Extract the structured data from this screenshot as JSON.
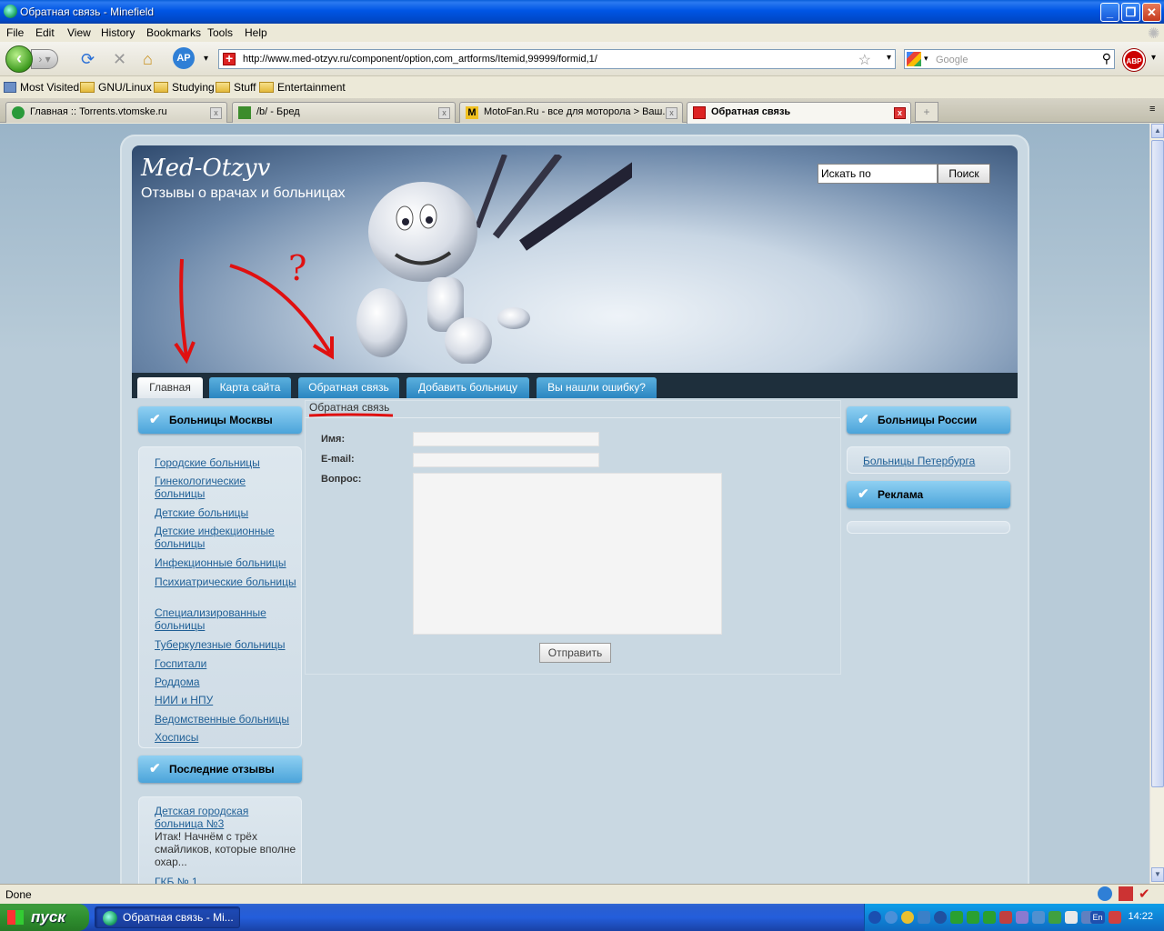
{
  "window": {
    "title": "Обратная связь - Minefield"
  },
  "menu": [
    "File",
    "Edit",
    "View",
    "History",
    "Bookmarks",
    "Tools",
    "Help"
  ],
  "address": {
    "url": "http://www.med-otzyv.ru/component/option,com_artforms/Itemid,99999/formid,1/"
  },
  "search": {
    "placeholder": "Google"
  },
  "bookmarks": [
    "Most Visited",
    "GNU/Linux",
    "Studying",
    "Stuff",
    "Entertainment"
  ],
  "tabs": [
    {
      "label": "Главная :: Torrents.vtomske.ru"
    },
    {
      "label": "/b/ - Бред"
    },
    {
      "label": "MotoFan.Ru - все для моторола > Ваш..."
    },
    {
      "label": "Обратная связь"
    }
  ],
  "site": {
    "name": "Med-Otzyv",
    "slogan": "Отзывы о врачах и больницах",
    "search_value": "Искать по",
    "search_button": "Поиск",
    "nav": [
      "Главная",
      "Карта сайта",
      "Обратная связь",
      "Добавить больницу",
      "Вы нашли ошибку?"
    ],
    "left": {
      "heading": "Больницы Москвы",
      "links": [
        "Городские больницы",
        "Гинекологические больницы",
        "Детские больницы",
        "Детские инфекционные больницы",
        "Инфекционные больницы",
        "Психиатрические больницы",
        "Специализированные больницы",
        "Туберкулезные больницы",
        "Госпитали",
        "Роддома",
        "НИИ и НПУ",
        "Ведомственные больницы",
        "Хосписы"
      ],
      "reviews_heading": "Последние отзывы",
      "review_link": "Детская городская больница №3",
      "review_text": "Итак! Начнём с трёх смайликов, которые вполне охар...",
      "review_link2": "ГКБ № 1"
    },
    "form": {
      "title": "Обратная связь",
      "name_label": "Имя:",
      "email_label": "E-mail:",
      "question_label": "Вопрос:",
      "submit": "Отправить"
    },
    "right": {
      "heading": "Больницы России",
      "link": "Больницы Петербурга",
      "ads_heading": "Реклама"
    },
    "annotation": "?"
  },
  "status": {
    "text": "Done"
  },
  "taskbar": {
    "start": "пуск",
    "task": "Обратная связь - Mi...",
    "lang": "En",
    "clock": "14:22"
  },
  "colors": {
    "accent": "#4ba4da",
    "annotation": "#e01010",
    "link": "#1f5f96"
  }
}
